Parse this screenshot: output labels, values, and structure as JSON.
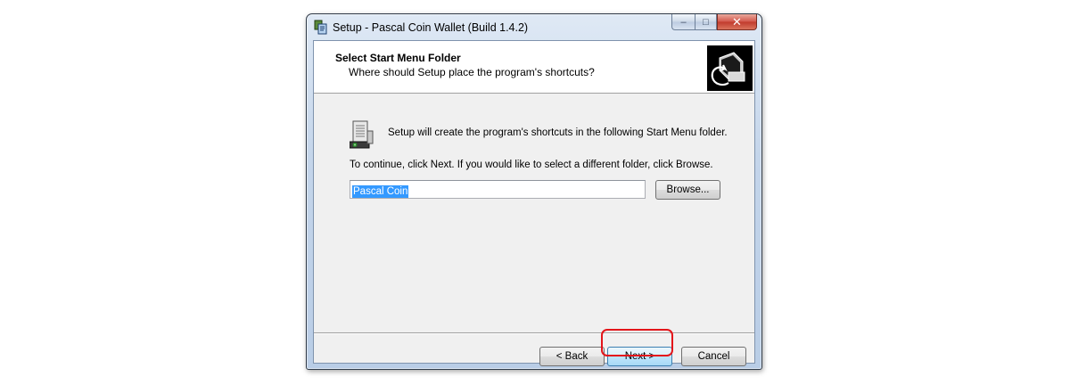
{
  "window": {
    "title": "Setup - Pascal Coin Wallet (Build 1.4.2)",
    "caption": {
      "minimize": "–",
      "maximize": "□",
      "close": "✕"
    }
  },
  "header": {
    "title": "Select Start Menu Folder",
    "subtitle": "Where should Setup place the program's shortcuts?"
  },
  "body": {
    "info": "Setup will create the program's shortcuts in the following Start Menu folder.",
    "instruction": "To continue, click Next. If you would like to select a different folder, click Browse.",
    "folder_value": "Pascal Coin",
    "browse_label": "Browse..."
  },
  "footer": {
    "back_label": "< Back",
    "next_label": "Next >",
    "cancel_label": "Cancel"
  },
  "colors": {
    "highlight": "#e3151a",
    "selection": "#3399ff"
  }
}
